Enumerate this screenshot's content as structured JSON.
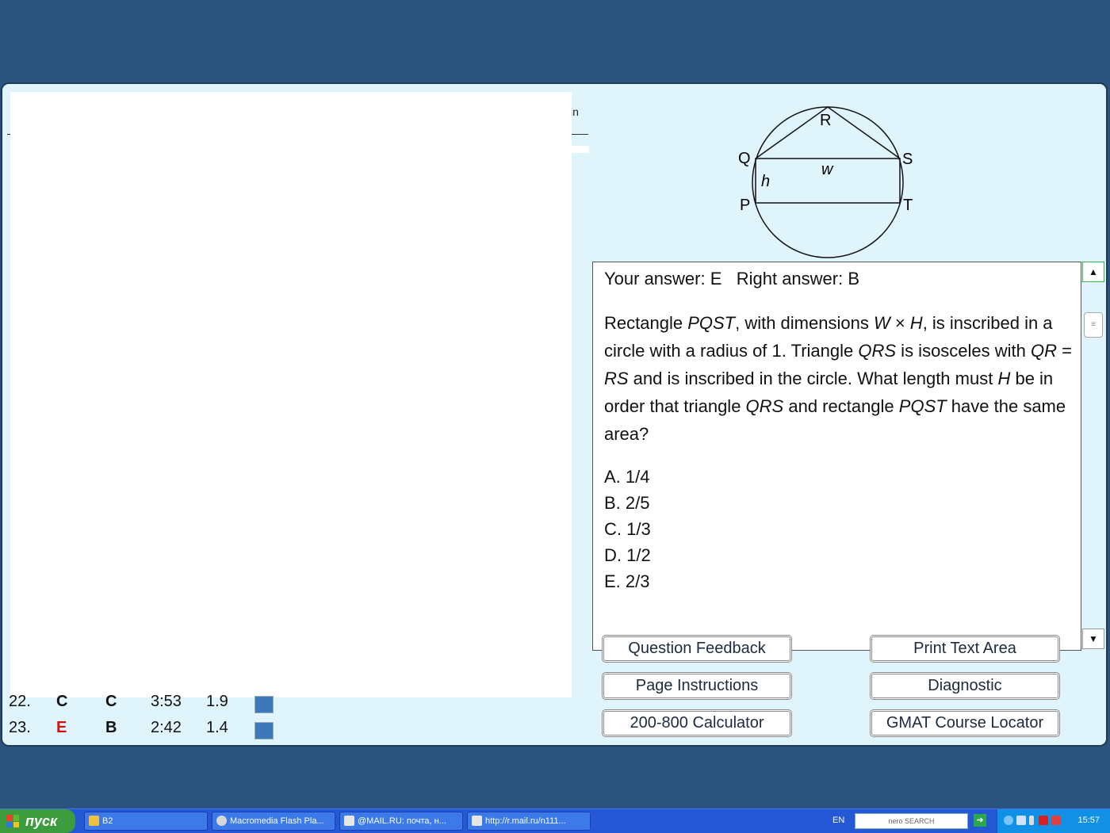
{
  "results": {
    "header_tail": "in",
    "rows": [
      {
        "num": "22.",
        "yours": "C",
        "right": "C",
        "time": "3:53",
        "difficulty": "1.9",
        "correct": true
      },
      {
        "num": "23.",
        "yours": "E",
        "right": "B",
        "time": "2:42",
        "difficulty": "1.4",
        "correct": false
      }
    ]
  },
  "diagram": {
    "labels": {
      "r": "R",
      "q": "Q",
      "s": "S",
      "p": "P",
      "t": "T",
      "h": "h",
      "w": "w"
    }
  },
  "question": {
    "answer_line": "Your answer: E   Right answer: B",
    "text_parts": [
      "Rectangle ",
      "PQST",
      ", with dimensions ",
      "W",
      " × ",
      "H",
      ", is inscribed in a circle with a radius of 1. Triangle ",
      "QRS",
      " is isosceles with ",
      "QR",
      " = ",
      "RS",
      " and is inscribed in the circle. What length must ",
      "H",
      " be in order that triangle ",
      "QRS",
      " and rectangle ",
      "PQST",
      " have the same area?"
    ],
    "choices": [
      "A. 1/4",
      "B. 2/5",
      "C. 1/3",
      "D. 1/2",
      "E. 2/3"
    ]
  },
  "scrollbar": {
    "up_icon": "▲",
    "down_icon": "▼",
    "thumb_icon": "≡"
  },
  "buttons": {
    "question_feedback": "Question Feedback",
    "print_text_area": "Print Text Area",
    "page_instructions": "Page Instructions",
    "diagnostic": "Diagnostic",
    "calculator": "200-800 Calculator",
    "course_locator": "GMAT Course Locator"
  },
  "taskbar": {
    "start_label": "пуск",
    "tasks": [
      {
        "label": "B2"
      },
      {
        "label": "Macromedia Flash Pla..."
      },
      {
        "label": "@MAIL.RU: почта, н..."
      },
      {
        "label": "http://r.mail.ru/n111..."
      }
    ],
    "language": "EN",
    "nero_label": "nero SEARCH",
    "clock": "15:57"
  },
  "colors": {
    "wrong_answer": "#cc1111",
    "marker": "#3d78b8",
    "window_bg": "#e0f5fb",
    "desktop_bg": "#2c527e"
  }
}
